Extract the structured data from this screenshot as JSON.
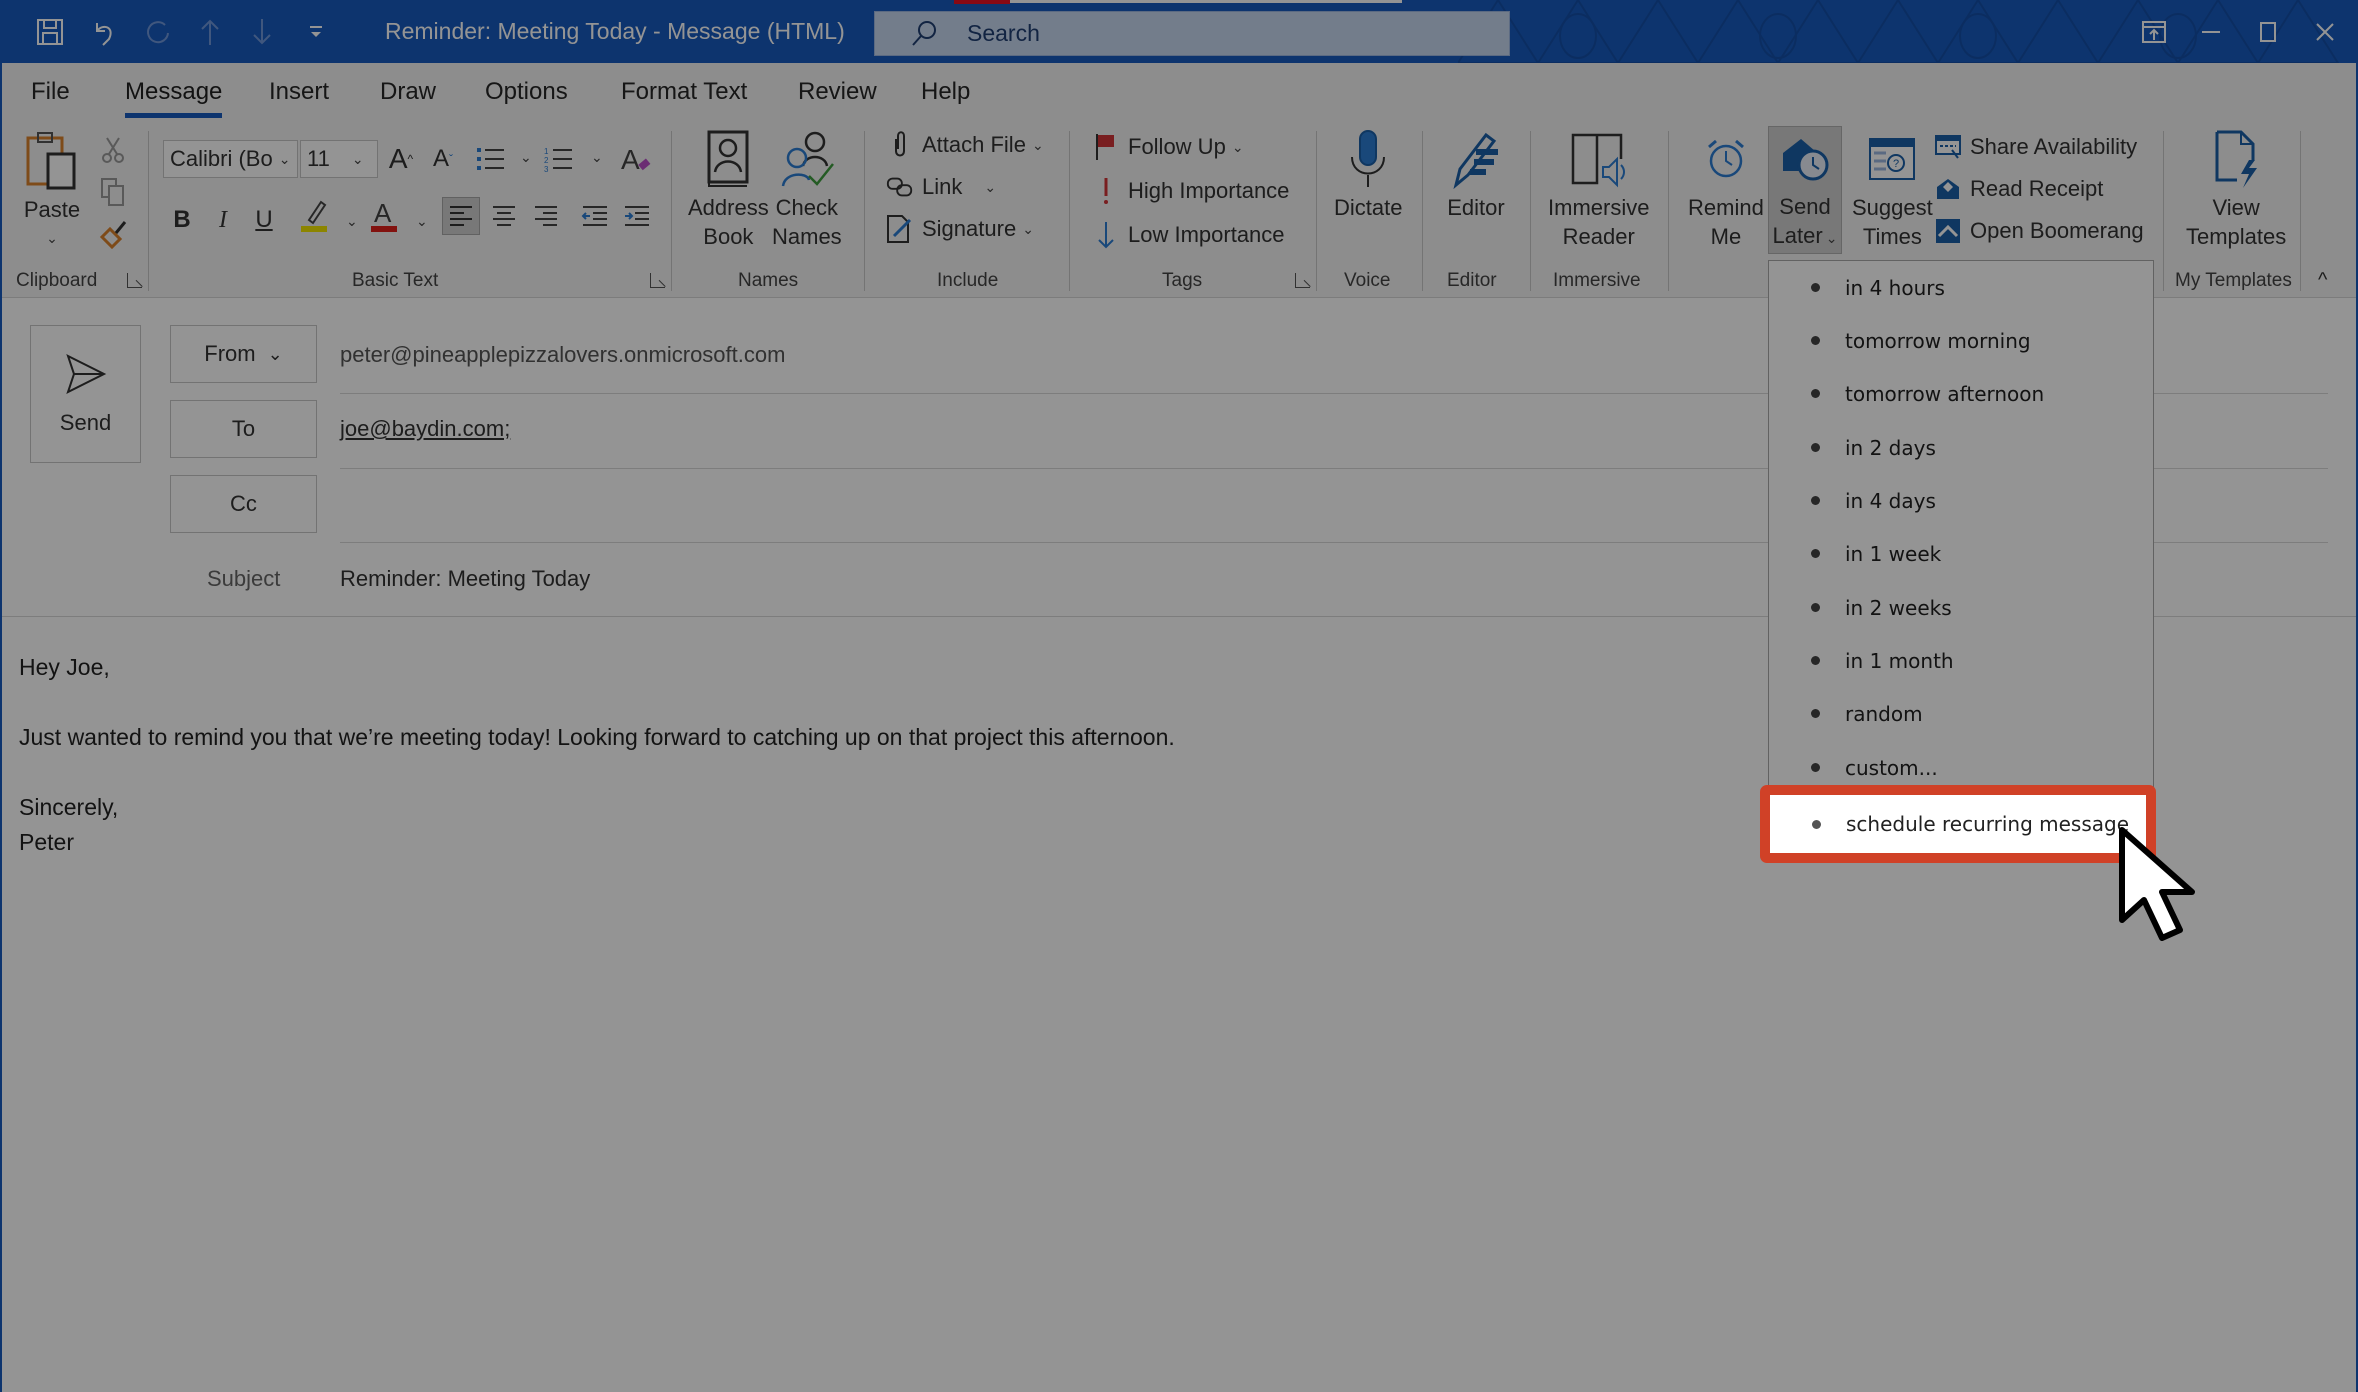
{
  "window": {
    "title": "Reminder: Meeting Today  -  Message (HTML)",
    "search_placeholder": "Search",
    "quick_access": [
      "save-icon",
      "undo-icon",
      "redo-icon",
      "up-icon",
      "down-icon",
      "customize-icon"
    ],
    "controls": [
      "coauthor-icon",
      "minimize-icon",
      "maximize-icon",
      "close-icon"
    ]
  },
  "tabs": [
    {
      "label": "File",
      "active": false
    },
    {
      "label": "Message",
      "active": true
    },
    {
      "label": "Insert",
      "active": false
    },
    {
      "label": "Draw",
      "active": false
    },
    {
      "label": "Options",
      "active": false
    },
    {
      "label": "Format Text",
      "active": false
    },
    {
      "label": "Review",
      "active": false
    },
    {
      "label": "Help",
      "active": false
    }
  ],
  "ribbon": {
    "clipboard": {
      "label": "Clipboard",
      "paste": "Paste"
    },
    "basic_text": {
      "label": "Basic Text",
      "font_name": "Calibri (Bo",
      "font_size": "11",
      "bold": "B",
      "italic": "I",
      "underline": "U",
      "font_color_letter": "A",
      "highlight_color": "#f2e600",
      "font_color": "#e0201b"
    },
    "names": {
      "label": "Names",
      "address_book": [
        "Address",
        "Book"
      ],
      "check_names": [
        "Check",
        "Names"
      ]
    },
    "include": {
      "label": "Include",
      "attach_file": "Attach File",
      "link": "Link",
      "signature": "Signature"
    },
    "tags": {
      "label": "Tags",
      "follow_up": "Follow Up",
      "high_importance": "High Importance",
      "low_importance": "Low Importance"
    },
    "voice": {
      "label": "Voice",
      "dictate": "Dictate"
    },
    "editor": {
      "label": "Editor",
      "editor": "Editor"
    },
    "immersive": {
      "label": "Immersive",
      "reader": [
        "Immersive",
        "Reader"
      ]
    },
    "boomerang": {
      "remind_me": [
        "Remind",
        "Me"
      ],
      "send_later": [
        "Send",
        "Later"
      ],
      "suggest_times": [
        "Suggest",
        "Times"
      ],
      "share_availability": "Share Availability",
      "read_receipt": "Read Receipt",
      "open_boomerang": "Open Boomerang"
    },
    "my_templates": {
      "label": "My Templates",
      "view_templates": [
        "View",
        "Templates"
      ]
    }
  },
  "compose": {
    "send_label": "Send",
    "from_label": "From",
    "from_value": "peter@pineapplepizzalovers.onmicrosoft.com",
    "to_label": "To",
    "to_value": "joe@baydin.com;",
    "cc_label": "Cc",
    "cc_value": "",
    "subject_label": "Subject",
    "subject_value": "Reminder: Meeting Today",
    "body": {
      "greeting": "Hey Joe,",
      "line1": "Just wanted to remind you that we’re meeting today! Looking forward to catching up on that project this afternoon.",
      "closing": "Sincerely,",
      "signature": "Peter"
    }
  },
  "send_later_menu": {
    "items": [
      "in 4 hours",
      "tomorrow morning",
      "tomorrow afternoon",
      "in 2 days",
      "in 4 days",
      "in 1 week",
      "in 2 weeks",
      "in 1 month",
      "random",
      "custom..."
    ],
    "highlighted_item": "schedule recurring message",
    "highlight_color": "#d04127"
  }
}
